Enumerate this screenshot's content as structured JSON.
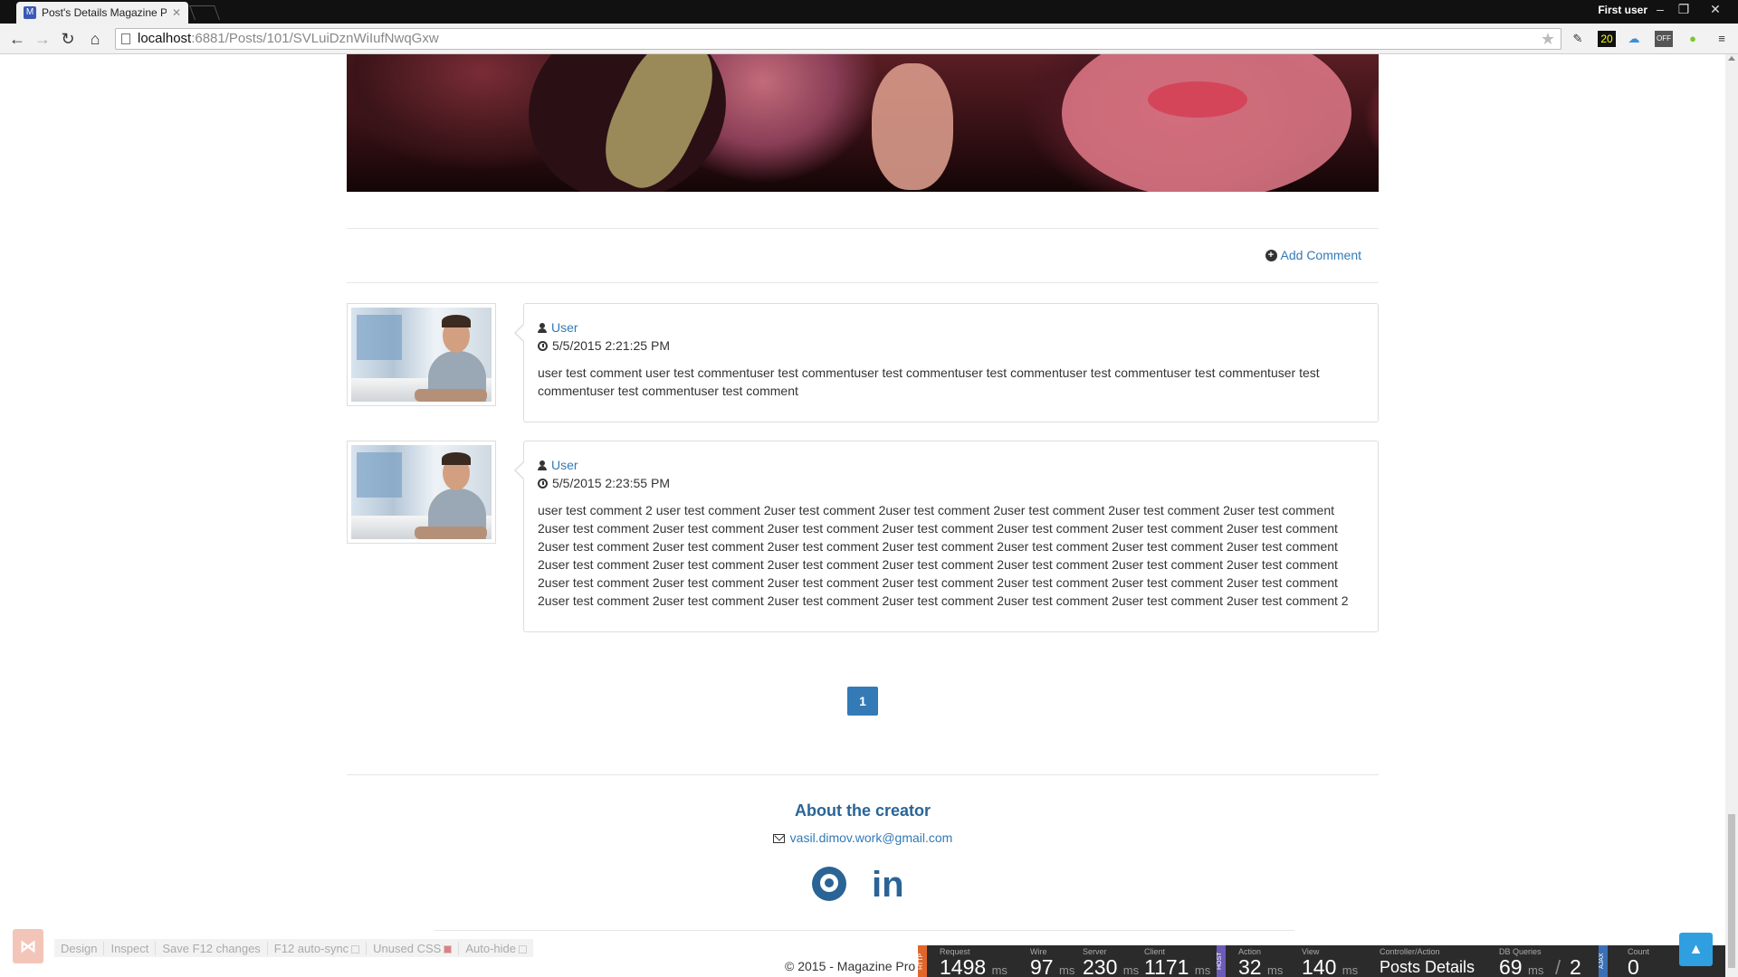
{
  "browser": {
    "tab_title": "Post's Details Magazine P",
    "tab_icon": "M",
    "profile": "First user",
    "url_host": "localhost",
    "url_path": ":6881/Posts/101/SVLuiDznWiIufNwqGxw",
    "ext_badge": "20",
    "ext_off": "OFF"
  },
  "page": {
    "add_comment_label": "Add Comment",
    "comments": [
      {
        "user": "User",
        "date": "5/5/2015 2:21:25 PM",
        "text": "user test comment user test commentuser test commentuser test commentuser test commentuser test commentuser test commentuser test commentuser test commentuser test comment"
      },
      {
        "user": "User",
        "date": "5/5/2015 2:23:55 PM",
        "text": "user test comment 2 user test comment 2user test comment 2user test comment 2user test comment 2user test comment 2user test comment 2user test comment 2user test comment 2user test comment 2user test comment 2user test comment 2user test comment 2user test comment 2user test comment 2user test comment 2user test comment 2user test comment 2user test comment 2user test comment 2user test comment 2user test comment 2user test comment 2user test comment 2user test comment 2user test comment 2user test comment 2user test comment 2user test comment 2user test comment 2user test comment 2user test comment 2user test comment 2user test comment 2user test comment 2user test comment 2user test comment 2user test comment 2user test comment 2user test comment 2user test comment 2user test comment 2"
      }
    ],
    "pagination": [
      "1"
    ],
    "footer": {
      "title": "About the creator",
      "email": "vasil.dimov.work@gmail.com",
      "copyright": "© 2015 - Magazine Pro"
    }
  },
  "browserlink": {
    "items": [
      "Design",
      "Inspect",
      "Save F12 changes",
      "F12 auto-sync",
      "Unused CSS",
      "Auto-hide"
    ]
  },
  "glimpse": {
    "request_label": "Request",
    "request": "1498",
    "wire_label": "Wire",
    "wire": "97",
    "server_label": "Server",
    "server": "230",
    "client_label": "Client",
    "client": "1171",
    "action_label": "Action",
    "action": "32",
    "view_label": "View",
    "view": "140",
    "controller_label": "Controller/Action",
    "controller": "Posts Details",
    "db_label": "DB Queries",
    "db_ms": "69",
    "db_count": "2",
    "count_label": "Count",
    "count": "0",
    "unit": "ms",
    "tag_http": "HTTP",
    "tag_host": "HOST",
    "tag_ajax": "AJAX"
  }
}
